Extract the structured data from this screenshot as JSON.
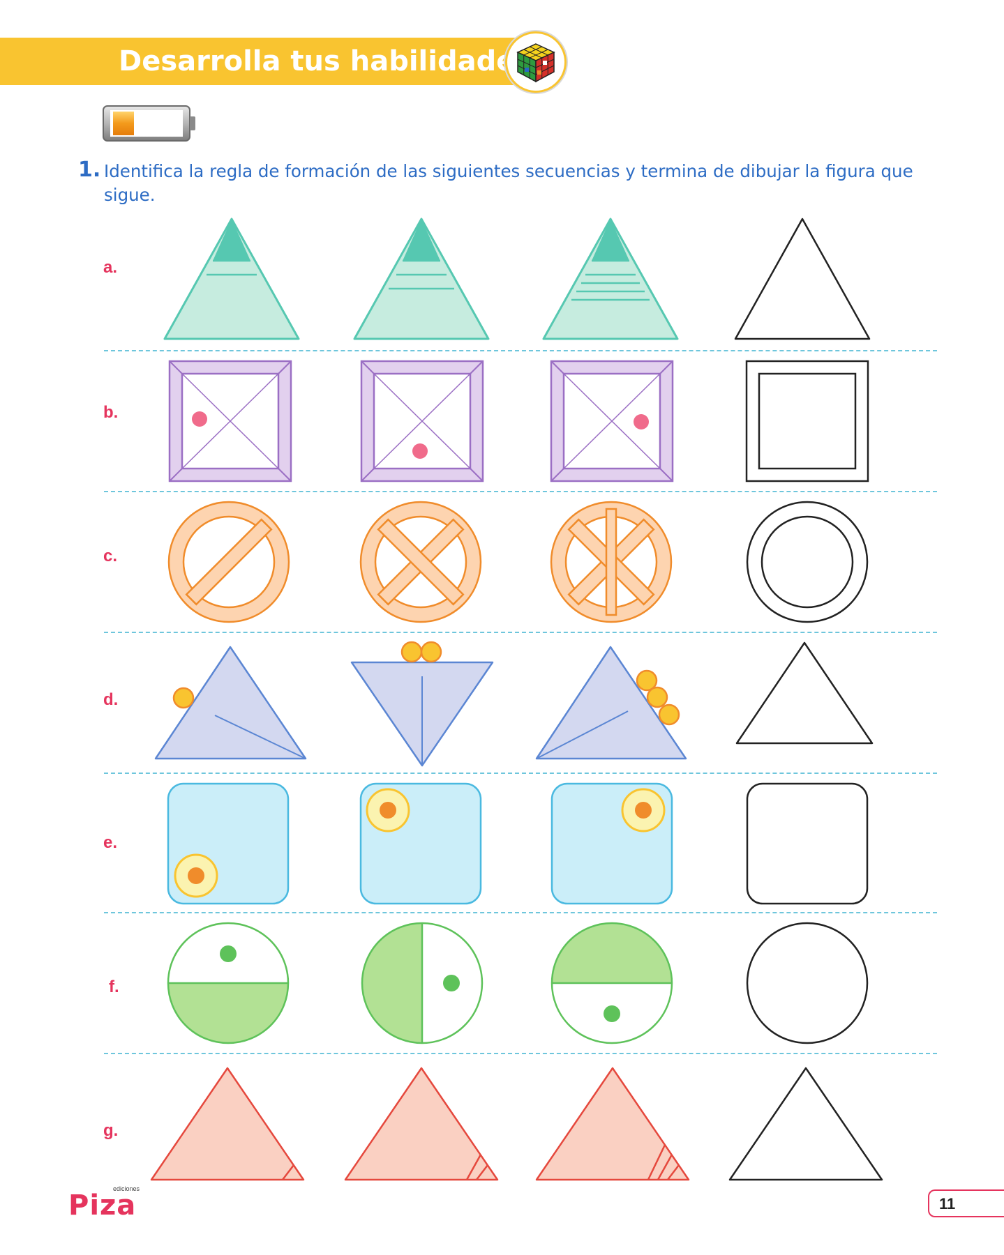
{
  "header": {
    "title": "Desarrolla tus habilidades",
    "badge_icon": "rubiks-cube-icon"
  },
  "battery_icon": "battery-low-icon",
  "question": {
    "number": "1.",
    "text": "Identifica la regla de formación de las siguientes secuencias y termina de dibujar la figura que sigue."
  },
  "rows": [
    {
      "label": "a."
    },
    {
      "label": "b."
    },
    {
      "label": "c."
    },
    {
      "label": "d."
    },
    {
      "label": "e."
    },
    {
      "label": "f."
    },
    {
      "label": "g."
    }
  ],
  "colors": {
    "header": "#f9c430",
    "accent_blue": "#2d6cc4",
    "label_red": "#e5345d",
    "teal": "#56c8b1",
    "purple": "#9b6fc4",
    "orange": "#f08c2b",
    "lavender": "#5b86d3",
    "sky": "#4ab9e0",
    "green": "#5ec25a",
    "salmon": "#e5483d"
  },
  "footer": {
    "publisher_small": "ediciones",
    "publisher": "Piza",
    "page_number": "11"
  }
}
